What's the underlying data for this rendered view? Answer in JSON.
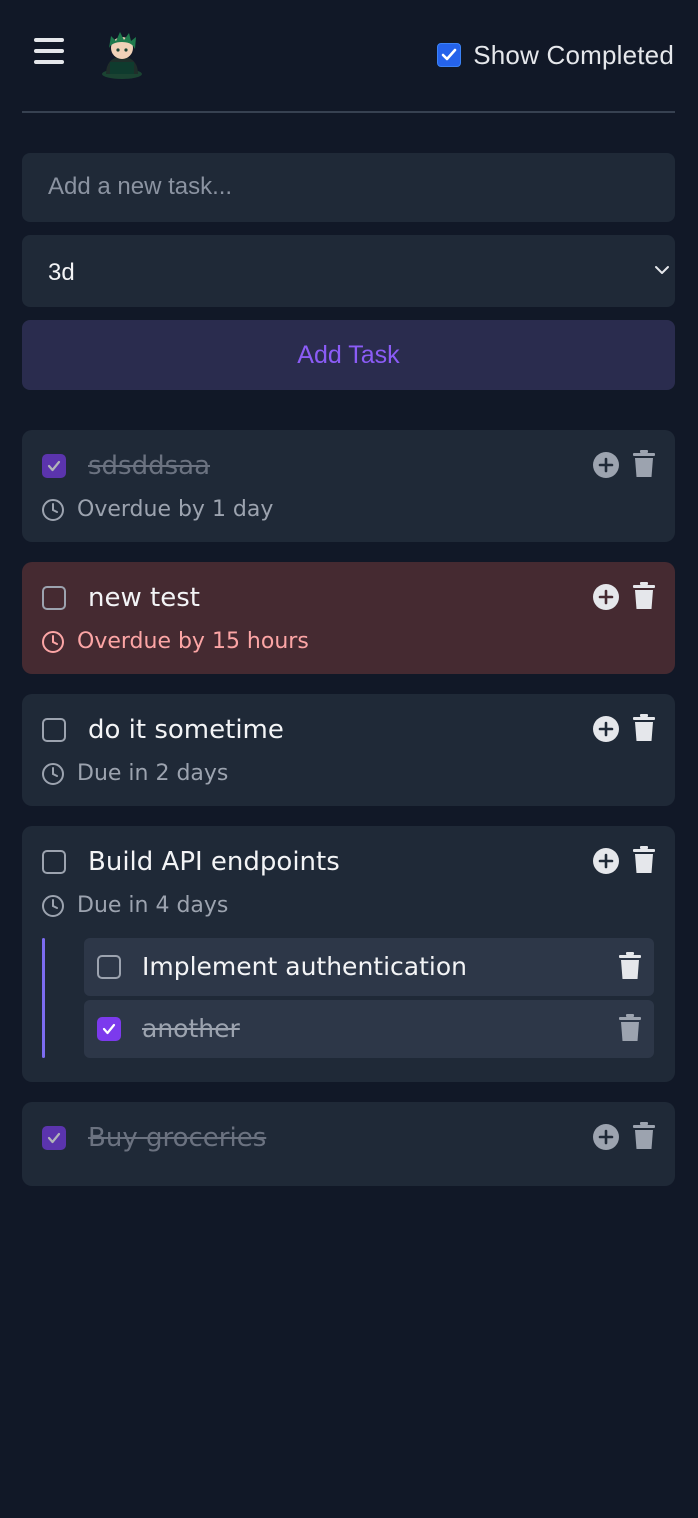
{
  "header": {
    "show_completed_label": "Show Completed",
    "show_completed_checked": true
  },
  "form": {
    "task_placeholder": "Add a new task...",
    "due_selected": "3d",
    "add_button_label": "Add Task"
  },
  "tasks": [
    {
      "title": "sdsddsaa",
      "completed": true,
      "due": "Overdue by 1 day",
      "overdue_highlight": false
    },
    {
      "title": "new test",
      "completed": false,
      "due": "Overdue by 15 hours",
      "overdue_highlight": true
    },
    {
      "title": "do it sometime",
      "completed": false,
      "due": "Due in 2 days",
      "overdue_highlight": false
    },
    {
      "title": "Build API endpoints",
      "completed": false,
      "due": "Due in 4 days",
      "overdue_highlight": false,
      "subtasks": [
        {
          "title": "Implement authentication",
          "completed": false
        },
        {
          "title": "another",
          "completed": true
        }
      ]
    },
    {
      "title": "Buy groceries",
      "completed": true,
      "due": "",
      "overdue_highlight": false
    }
  ],
  "colors": {
    "background": "#111827",
    "card": "#1f2937",
    "overdue_card": "#452a31",
    "accent": "#7c3aed",
    "overdue_text": "#fca5a5"
  },
  "icons": {
    "menu": "hamburger-menu-icon",
    "avatar": "avatar-icon",
    "clock": "clock-icon",
    "add_subtask": "plus-circle-icon",
    "delete": "trash-icon",
    "dropdown": "chevron-down-icon"
  }
}
